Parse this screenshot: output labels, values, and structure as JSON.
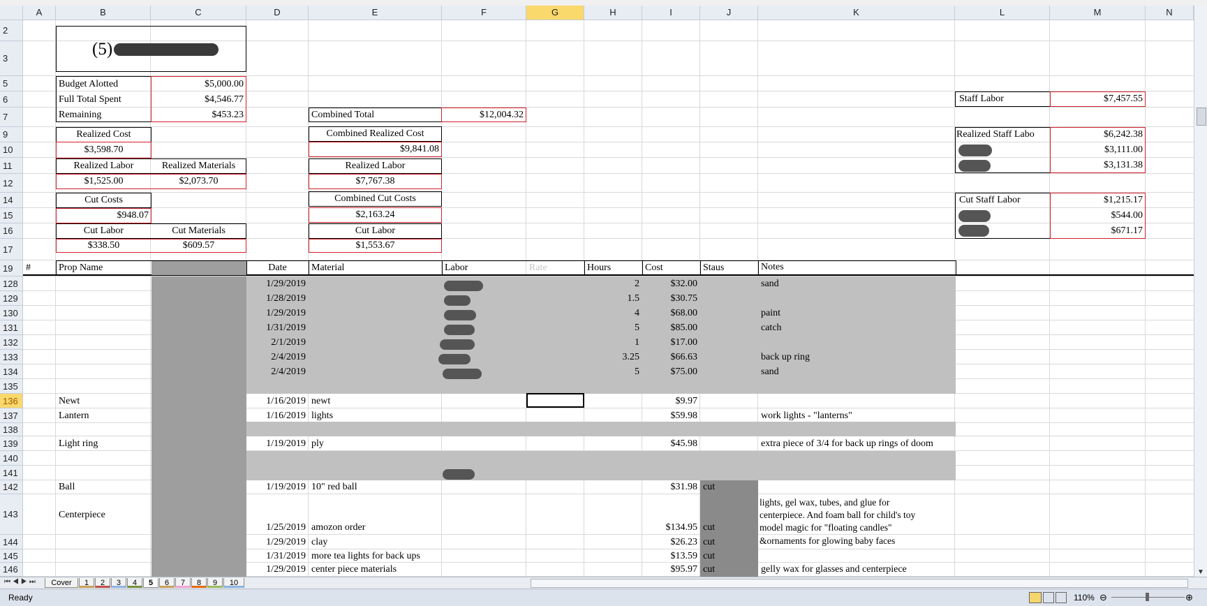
{
  "columns": [
    "A",
    "B",
    "C",
    "D",
    "E",
    "F",
    "G",
    "H",
    "I",
    "J",
    "K",
    "L",
    "M",
    "N"
  ],
  "rows": [
    "2",
    "3",
    "5",
    "6",
    "7",
    "9",
    "10",
    "11",
    "12",
    "14",
    "15",
    "16",
    "17",
    "19",
    "128",
    "129",
    "130",
    "131",
    "132",
    "133",
    "134",
    "135",
    "136",
    "137",
    "138",
    "139",
    "140",
    "141",
    "142",
    "143",
    "144",
    "145",
    "146"
  ],
  "title_prefix": "(5)",
  "budget": {
    "budget_label": "Budget Alotted",
    "budget_value": "$5,000.00",
    "spent_label": "Full Total Spent",
    "spent_value": "$4,546.77",
    "remaining_label": "Remaining",
    "remaining_value": "$453.23"
  },
  "realized": {
    "cost_label": "Realized Cost",
    "cost_value": "$3,598.70",
    "labor_label": "Realized Labor",
    "materials_label": "Realized Materials",
    "labor_value": "$1,525.00",
    "materials_value": "$2,073.70"
  },
  "cut": {
    "cost_label": "Cut Costs",
    "cost_value": "$948.07",
    "labor_label": "Cut Labor",
    "materials_label": "Cut Materials",
    "labor_value": "$338.50",
    "materials_value": "$609.57"
  },
  "combined": {
    "total_label": "Combined Total",
    "total_value": "$12,004.32",
    "realized_label": "Combined Realized  Cost",
    "realized_value": "$9,841.08",
    "realized_labor_label": "Realized Labor",
    "realized_labor_value": "$7,767.38",
    "cut_label": "Combined Cut Costs",
    "cut_value": "$2,163.24",
    "cut_labor_label": "Cut Labor",
    "cut_labor_value": "$1,553.67"
  },
  "staff": {
    "labor_label": "Staff Labor",
    "labor_value": "$7,457.55",
    "realized_label": "Realized Staff Labo",
    "realized_value": "$6,242.38",
    "realized_p1": "$3,111.00",
    "realized_p2": "$3,131.38",
    "cut_label": "Cut Staff Labor",
    "cut_value": "$1,215.17",
    "cut_p1": "$544.00",
    "cut_p2": "$671.17"
  },
  "table_headers": {
    "num": "#",
    "prop": "Prop Name",
    "date": "Date",
    "material": "Material",
    "labor": "Labor",
    "rate": "Rate",
    "hours": "Hours",
    "cost": "Cost",
    "status": "Staus",
    "notes": "Notes"
  },
  "table_rows": [
    {
      "row": "128",
      "prop": "",
      "date": "1/29/2019",
      "material": "",
      "hours": "2",
      "cost": "$32.00",
      "status": "",
      "notes": "sand"
    },
    {
      "row": "129",
      "prop": "",
      "date": "1/28/2019",
      "material": "",
      "hours": "1.5",
      "cost": "$30.75",
      "status": "",
      "notes": ""
    },
    {
      "row": "130",
      "prop": "",
      "date": "1/29/2019",
      "material": "",
      "hours": "4",
      "cost": "$68.00",
      "status": "",
      "notes": "paint"
    },
    {
      "row": "131",
      "prop": "",
      "date": "1/31/2019",
      "material": "",
      "hours": "5",
      "cost": "$85.00",
      "status": "",
      "notes": "catch"
    },
    {
      "row": "132",
      "prop": "",
      "date": "2/1/2019",
      "material": "",
      "hours": "1",
      "cost": "$17.00",
      "status": "",
      "notes": ""
    },
    {
      "row": "133",
      "prop": "",
      "date": "2/4/2019",
      "material": "",
      "hours": "3.25",
      "cost": "$66.63",
      "status": "",
      "notes": "back up ring"
    },
    {
      "row": "134",
      "prop": "",
      "date": "2/4/2019",
      "material": "",
      "hours": "5",
      "cost": "$75.00",
      "status": "",
      "notes": "sand"
    },
    {
      "row": "135",
      "prop": "",
      "date": "",
      "material": "",
      "hours": "",
      "cost": "",
      "status": "",
      "notes": ""
    },
    {
      "row": "136",
      "prop": "Newt",
      "date": "1/16/2019",
      "material": "newt",
      "hours": "",
      "cost": "$9.97",
      "status": "",
      "notes": ""
    },
    {
      "row": "137",
      "prop": "Lantern",
      "date": "1/16/2019",
      "material": "lights",
      "hours": "",
      "cost": "$59.98",
      "status": "",
      "notes": "work lights - \"lanterns\""
    },
    {
      "row": "138",
      "prop": "",
      "date": "",
      "material": "",
      "hours": "",
      "cost": "",
      "status": "",
      "notes": ""
    },
    {
      "row": "139",
      "prop": "Light ring",
      "date": "1/19/2019",
      "material": "ply",
      "hours": "",
      "cost": "$45.98",
      "status": "",
      "notes": "extra piece of 3/4 for back up rings of doom"
    },
    {
      "row": "140",
      "prop": "",
      "date": "",
      "material": "",
      "hours": "",
      "cost": "",
      "status": "",
      "notes": ""
    },
    {
      "row": "141",
      "prop": "",
      "date": "",
      "material": "",
      "hours": "",
      "cost": "",
      "status": "",
      "notes": ""
    },
    {
      "row": "142",
      "prop": "Ball",
      "date": "1/19/2019",
      "material": "10\" red ball",
      "hours": "",
      "cost": "$31.98",
      "status": "cut",
      "notes": ""
    },
    {
      "row": "143",
      "prop": "Centerpiece",
      "date": "1/25/2019",
      "material": "amozon order",
      "hours": "",
      "cost": "$134.95",
      "status": "cut",
      "notes": "lights, gel wax, tubes, and glue for centerpiece. And foam ball for child's toy"
    },
    {
      "row": "144",
      "prop": "",
      "date": "1/29/2019",
      "material": "clay",
      "hours": "",
      "cost": "$26.23",
      "status": "cut",
      "notes": "model magic for \"floating candles\" &ornaments for glowing baby faces"
    },
    {
      "row": "145",
      "prop": "",
      "date": "1/31/2019",
      "material": "more tea lights for back ups",
      "hours": "",
      "cost": "$13.59",
      "status": "cut",
      "notes": ""
    },
    {
      "row": "146",
      "prop": "",
      "date": "1/29/2019",
      "material": "center piece materials",
      "hours": "",
      "cost": "$95.97",
      "status": "cut",
      "notes": "gelly wax for glasses and centerpiece"
    }
  ],
  "notes_143_lines": [
    "lights, gel wax, tubes, and glue for",
    "centerpiece. And foam ball for child's toy"
  ],
  "notes_144_lines": [
    "model magic for \"floating candles\"",
    "&ornaments for glowing baby faces"
  ],
  "sheet_tabs": [
    "Cover",
    "1",
    "2",
    "3",
    "4",
    "5",
    "6",
    "7",
    "8",
    "9",
    "10"
  ],
  "active_tab": "5",
  "status_text": "Ready",
  "zoom": "110%"
}
